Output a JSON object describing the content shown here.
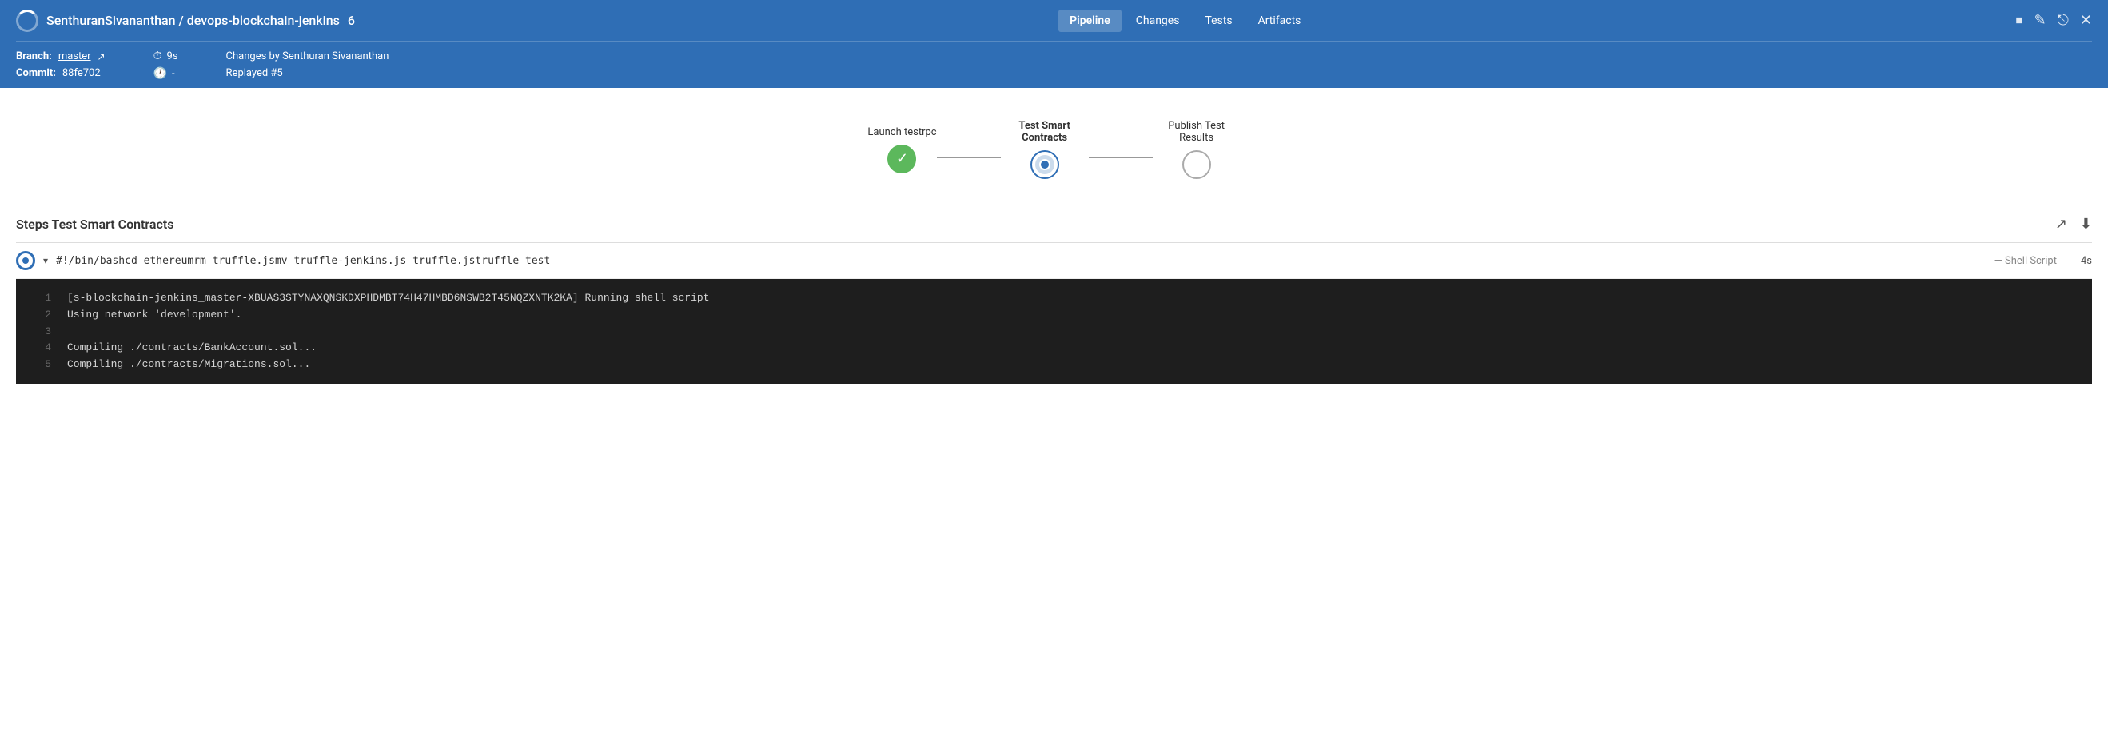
{
  "header": {
    "title_link": "SenthuranSivananthan / devops-blockchain-jenkins",
    "build_number": "6",
    "nav_items": [
      {
        "id": "pipeline",
        "label": "Pipeline",
        "active": true
      },
      {
        "id": "changes",
        "label": "Changes",
        "active": false
      },
      {
        "id": "tests",
        "label": "Tests",
        "active": false
      },
      {
        "id": "artifacts",
        "label": "Artifacts",
        "active": false
      }
    ],
    "meta": {
      "branch_label": "Branch:",
      "branch_value": "master",
      "commit_label": "Commit:",
      "commit_value": "88fe702",
      "duration_label": "9s",
      "time_label": "-",
      "changes_text": "Changes by Senthuran Sivananthan",
      "replayed_text": "Replayed #5"
    }
  },
  "pipeline": {
    "stages": [
      {
        "id": "launch",
        "label": "Launch testrpc",
        "bold": false,
        "status": "success"
      },
      {
        "id": "test-contracts",
        "label": "Test Smart Contracts",
        "bold": true,
        "status": "running"
      },
      {
        "id": "publish",
        "label": "Publish Test Results",
        "bold": false,
        "status": "pending"
      }
    ]
  },
  "steps": {
    "title": "Steps Test Smart Contracts",
    "step": {
      "label": "#!/bin/bashcd ethereumrm truffle.jsmv truffle-jenkins.js truffle.jstruffle test",
      "type": "— Shell Script",
      "duration": "4s"
    },
    "log_lines": [
      {
        "num": "1",
        "text": "[s-blockchain-jenkins_master-XBUAS3STYNAXQNSKDXPHDMBT74H47HMBD6NSWB2T45NQZXNTK2KA] Running shell script"
      },
      {
        "num": "2",
        "text": "Using network 'development'."
      },
      {
        "num": "3",
        "text": ""
      },
      {
        "num": "4",
        "text": "Compiling ./contracts/BankAccount.sol..."
      },
      {
        "num": "5",
        "text": "Compiling ./contracts/Migrations.sol..."
      }
    ]
  },
  "icons": {
    "external_link": "↗",
    "download": "⬇",
    "stop": "⏹",
    "edit": "✎",
    "logout": "⎋",
    "close": "✕"
  }
}
